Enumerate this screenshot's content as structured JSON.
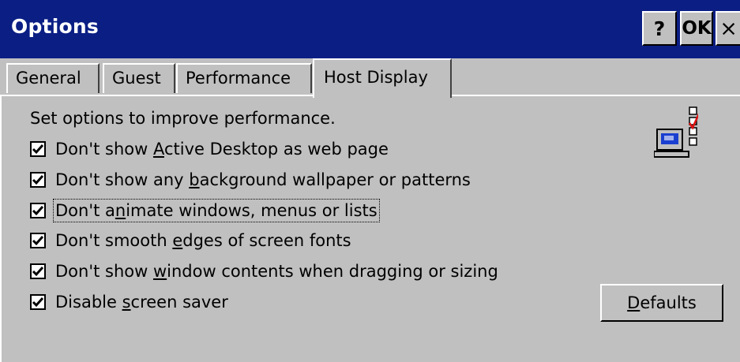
{
  "window": {
    "title": "Options",
    "help_label": "?",
    "ok_label": "OK",
    "close_label": "×"
  },
  "tabs": [
    {
      "label": "General",
      "selected": false
    },
    {
      "label": "Guest",
      "selected": false
    },
    {
      "label": "Performance",
      "selected": false
    },
    {
      "label": "Host Display",
      "selected": true
    }
  ],
  "host_display": {
    "intro": "Set options to improve performance.",
    "options": [
      {
        "pre": "Don't show ",
        "mnemonic": "A",
        "post": "ctive Desktop as web page",
        "checked": true
      },
      {
        "pre": "Don't show any ",
        "mnemonic": "b",
        "post": "ackground wallpaper or patterns",
        "checked": true
      },
      {
        "pre": "Don't a",
        "mnemonic": "n",
        "post": "imate windows, menus or lists",
        "checked": true
      },
      {
        "pre": "Don't smooth ",
        "mnemonic": "e",
        "post": "dges of screen fonts",
        "checked": true
      },
      {
        "pre": "Don't show ",
        "mnemonic": "w",
        "post": "indow contents when dragging or sizing",
        "checked": true
      },
      {
        "pre": "Disable ",
        "mnemonic": "s",
        "post": "creen saver",
        "checked": true
      }
    ],
    "defaults_button": {
      "mnemonic": "D",
      "rest": "efaults"
    },
    "icon": "performance-checklist-icon"
  },
  "colors": {
    "titlebar": "#0a1e84",
    "face": "#c0c0c0",
    "check": "#000000",
    "icon_check": "#e01010",
    "icon_monitor": "#1a3fd0"
  }
}
